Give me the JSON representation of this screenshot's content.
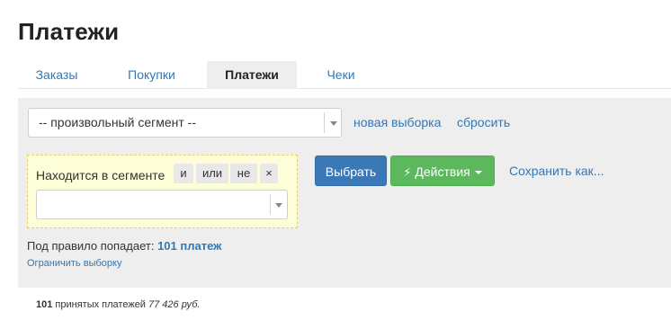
{
  "page": {
    "title": "Платежи"
  },
  "tabs": [
    {
      "label": "Заказы",
      "active": false
    },
    {
      "label": "Покупки",
      "active": false
    },
    {
      "label": "Платежи",
      "active": true
    },
    {
      "label": "Чеки",
      "active": false
    }
  ],
  "segment": {
    "selected": "-- произвольный сегмент --",
    "new_selection_label": "новая выборка",
    "reset_label": "сбросить"
  },
  "condition": {
    "label": "Находится в сегменте",
    "ops": [
      "и",
      "или",
      "не",
      "×"
    ],
    "value": ""
  },
  "actions": {
    "select_label": "Выбрать",
    "actions_label": "Действия",
    "save_as_label": "Сохранить как..."
  },
  "rule": {
    "prefix": "Под правило попадает:",
    "count_label": "101 платеж",
    "limit_label": "Ограничить выборку"
  },
  "summary": {
    "count": "101",
    "text": "принятых платежей",
    "amount": "77 426 руб."
  },
  "colors": {
    "link": "#3477b5",
    "primary_button": "#3a78b7",
    "success_button": "#5cb85c",
    "panel_background": "#eeeeee",
    "condition_background": "#fdfdd8"
  },
  "icons": {
    "bolt": "bolt-icon",
    "caret": "caret-down-icon",
    "remove": "remove-icon"
  }
}
